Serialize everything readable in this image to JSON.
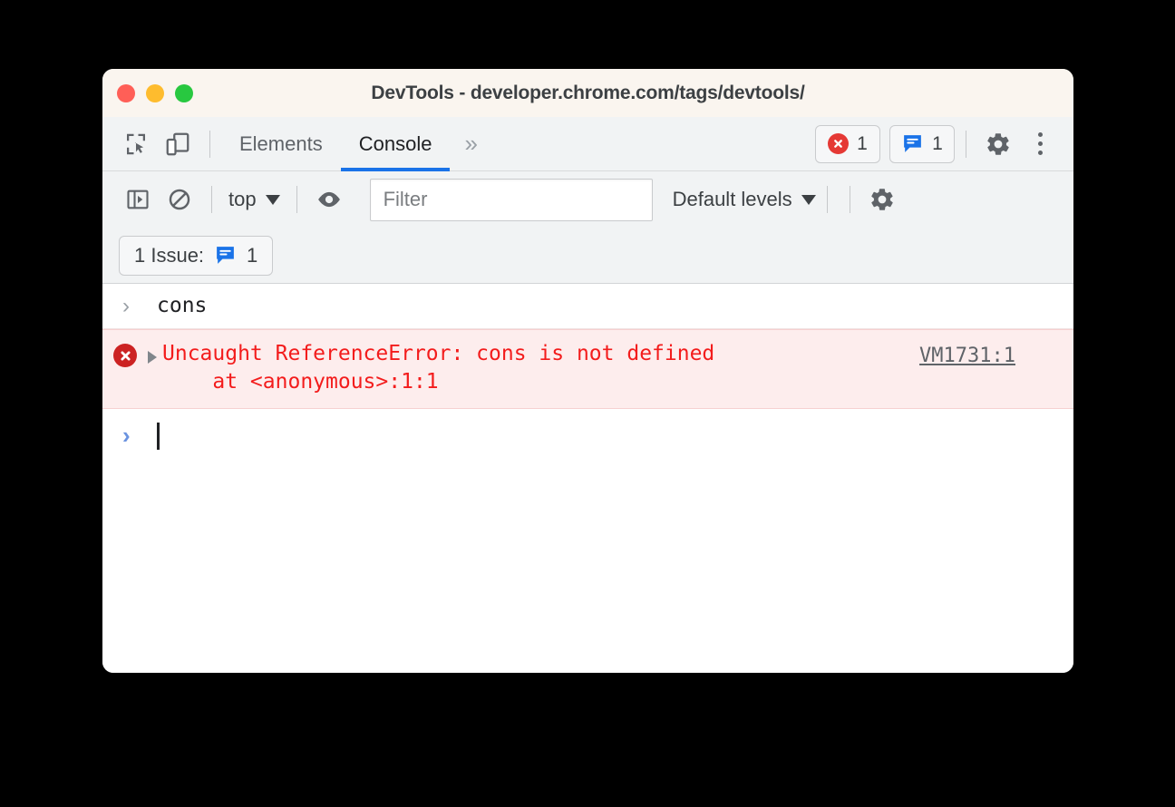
{
  "window": {
    "title": "DevTools - developer.chrome.com/tags/devtools/",
    "traffic_lights": {
      "close_color": "#FF5F57",
      "minimize_color": "#FEBC2E",
      "maximize_color": "#28C840"
    }
  },
  "tabbar": {
    "inspect_icon": "inspect-element-icon",
    "device_icon": "device-toolbar-icon",
    "tabs": [
      {
        "label": "Elements",
        "active": false
      },
      {
        "label": "Console",
        "active": true
      }
    ],
    "more_tabs_label": "»",
    "error_count": "1",
    "issue_count": "1",
    "settings_icon": "gear-icon",
    "menu_icon": "kebab-menu-icon",
    "active_tab_underline_color": "#1A73E8"
  },
  "console_toolbar": {
    "sidebar_toggle_icon": "console-sidebar-icon",
    "clear_icon": "clear-console-icon",
    "context": "top",
    "eye_icon": "live-expression-eye-icon",
    "filter_placeholder": "Filter",
    "filter_value": "",
    "levels": "Default levels",
    "settings_icon": "gear-icon"
  },
  "issues_bar": {
    "label": "1 Issue:",
    "count": "1",
    "badge_color": "#1A73E8"
  },
  "console": {
    "rows": [
      {
        "type": "input",
        "prompt": "›",
        "text": "cons"
      },
      {
        "type": "error",
        "message_line1": "Uncaught ReferenceError: cons is not defined",
        "message_line2": "    at <anonymous>:1:1",
        "source_link": "VM1731:1",
        "text_color": "#F31C1C",
        "background_color": "#FDEDED"
      },
      {
        "type": "prompt",
        "prompt": "›",
        "text": ""
      }
    ]
  }
}
